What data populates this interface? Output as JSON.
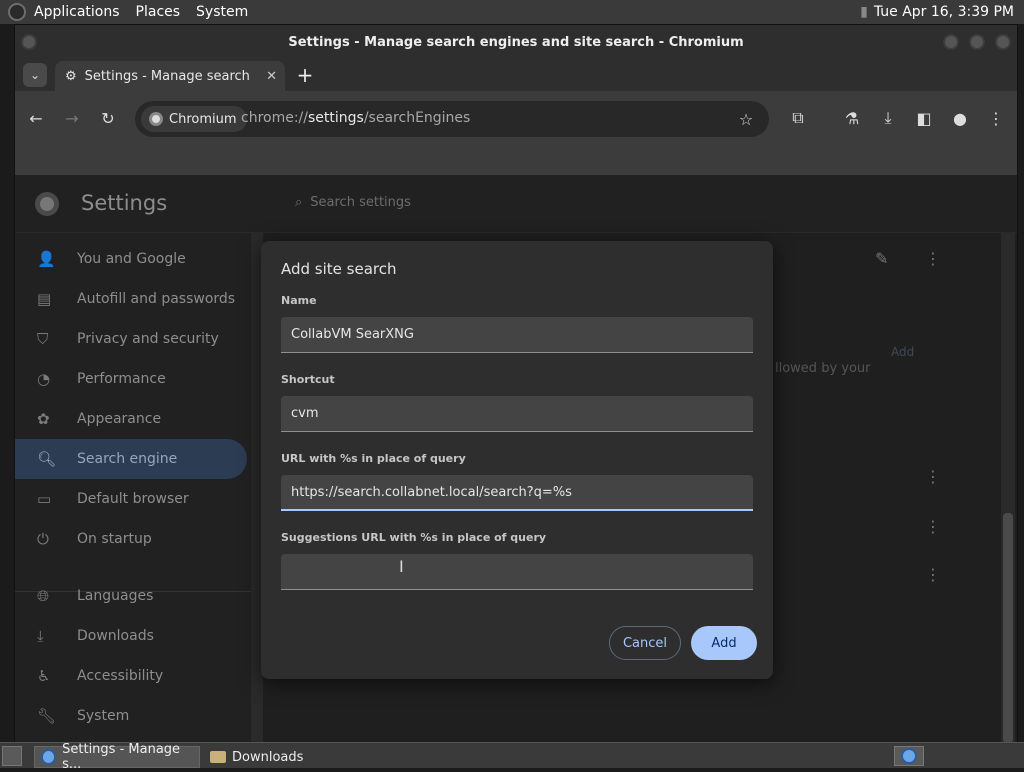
{
  "panel": {
    "menus": [
      "Applications",
      "Places",
      "System"
    ],
    "clock": "Tue Apr 16,  3:39 PM"
  },
  "window": {
    "title": "Settings - Manage search engines and site search - Chromium"
  },
  "tab": {
    "label": "Settings - Manage search engines and site search",
    "new_tab_icon": "plus-icon"
  },
  "omnibox": {
    "chip": "Chromium",
    "url_prefix": "chrome://",
    "url_host": "settings",
    "url_path": "/searchEngines"
  },
  "settings": {
    "title": "Settings",
    "search_placeholder": "Search settings",
    "nav": [
      {
        "label": "You and Google",
        "icon": "person-icon"
      },
      {
        "label": "Autofill and passwords",
        "icon": "clipboard-icon"
      },
      {
        "label": "Privacy and security",
        "icon": "shield-icon"
      },
      {
        "label": "Performance",
        "icon": "gauge-icon"
      },
      {
        "label": "Appearance",
        "icon": "palette-icon"
      },
      {
        "label": "Search engine",
        "icon": "search-icon",
        "selected": true
      },
      {
        "label": "Default browser",
        "icon": "browser-icon"
      },
      {
        "label": "On startup",
        "icon": "power-icon"
      },
      {
        "label": "Languages",
        "icon": "globe-icon"
      },
      {
        "label": "Downloads",
        "icon": "download-icon"
      },
      {
        "label": "Accessibility",
        "icon": "accessibility-icon"
      },
      {
        "label": "System",
        "icon": "wrench-icon"
      }
    ],
    "bg_add": "Add",
    "bg_text": "llowed by your"
  },
  "dialog": {
    "title": "Add site search",
    "name_label": "Name",
    "name_value": "CollabVM SearXNG",
    "shortcut_label": "Shortcut",
    "shortcut_value": "cvm",
    "url_label": "URL with %s in place of query",
    "url_value": "https://search.collabnet.local/search?q=%s",
    "suggest_label": "Suggestions URL with %s in place of query",
    "suggest_value": "",
    "cancel": "Cancel",
    "add": "Add"
  },
  "taskbar": {
    "items": [
      "Settings - Manage s...",
      "Downloads"
    ]
  },
  "colors": {
    "accent": "#a8c7fa",
    "selected_nav": "#2c3c52"
  }
}
